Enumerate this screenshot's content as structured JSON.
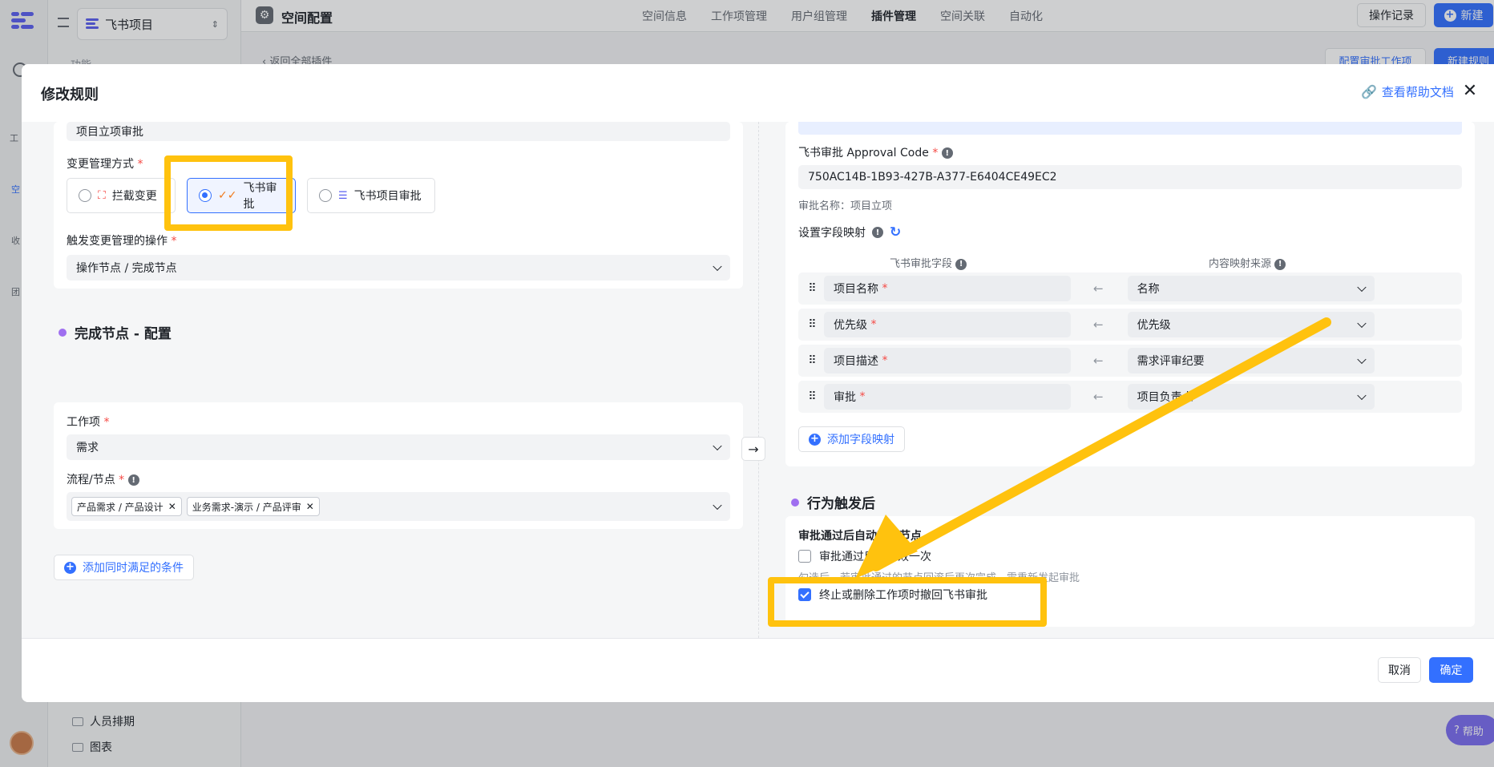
{
  "app": {
    "project_name": "飞书项目",
    "header_title": "空间配置",
    "nav_tabs": [
      "空间信息",
      "工作项管理",
      "用户组管理",
      "插件管理",
      "空间关联",
      "自动化"
    ],
    "op_log": "操作记录",
    "new_btn": "新建",
    "back_link": "返回全部插件",
    "cfg_btn": "配置审批工作项",
    "new_rule_btn": "新建规则",
    "side_label": "功能",
    "side_items": [
      "人员排期",
      "图表"
    ],
    "rail_items": [
      "工",
      "空",
      "收",
      "团"
    ],
    "help_fab": "帮助"
  },
  "modal": {
    "title": "修改规则",
    "help_link": "查看帮助文档",
    "cancel": "取消",
    "confirm": "确定"
  },
  "left": {
    "top_field_value": "项目立项审批",
    "change_mode_label": "变更管理方式",
    "modes": [
      "拦截变更",
      "飞书审批",
      "飞书项目审批"
    ],
    "trigger_label": "触发变更管理的操作",
    "trigger_value": "操作节点 / 完成节点",
    "section_title": "完成节点 - 配置",
    "workitem_label": "工作项",
    "workitem_value": "需求",
    "flow_label": "流程/节点",
    "flow_tags": [
      "产品需求 / 产品设计",
      "业务需求-演示 / 产品评审"
    ],
    "add_cond": "添加同时满足的条件"
  },
  "right": {
    "approval_code_label": "飞书审批 Approval Code",
    "approval_code": "750AC14B-1B93-427B-A377-E6404CE49EC2",
    "approval_name": "审批名称：项目立项",
    "mapping_label": "设置字段映射",
    "col_field": "飞书审批字段",
    "col_source": "内容映射来源",
    "rows": [
      {
        "field": "项目名称",
        "source": "名称"
      },
      {
        "field": "优先级",
        "source": "优先级"
      },
      {
        "field": "项目描述",
        "source": "需求评审纪要"
      },
      {
        "field": "审批",
        "source": "项目负责人"
      }
    ],
    "add_mapping": "添加字段映射",
    "after_title": "行为触发后",
    "auto_complete": "审批通过后自动完成节点",
    "once_label": "审批通过后仅生效一次",
    "hint": "勾选后，若审批通过的节点回滚后再次完成，需重新发起审批",
    "revoke_label": "终止或删除工作项时撤回飞书审批"
  },
  "colors": {
    "accent": "#3370ff",
    "highlight": "#ffc20e",
    "section_dot": "#9f6ff0"
  }
}
